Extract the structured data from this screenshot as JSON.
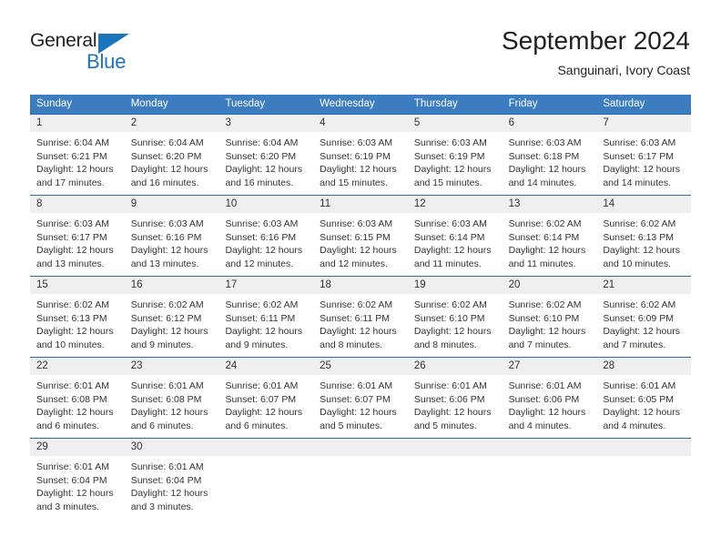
{
  "brand": {
    "name_top": "General",
    "name_bottom": "Blue",
    "accent_color": "#1b75bc",
    "triangle_icon": "triangle-icon"
  },
  "header": {
    "title": "September 2024",
    "subtitle": "Sanguinari, Ivory Coast"
  },
  "theme": {
    "header_row_bg": "#3b7dc0",
    "date_band_bg": "#efefef",
    "row_divider": "#2a6aad",
    "text_color": "#333333"
  },
  "calendar": {
    "weekday_headers": [
      "Sunday",
      "Monday",
      "Tuesday",
      "Wednesday",
      "Thursday",
      "Friday",
      "Saturday"
    ],
    "weeks": [
      {
        "days": [
          {
            "date": "1",
            "sunrise": "Sunrise: 6:04 AM",
            "sunset": "Sunset: 6:21 PM",
            "daylight_line1": "Daylight: 12 hours",
            "daylight_line2": "and 17 minutes."
          },
          {
            "date": "2",
            "sunrise": "Sunrise: 6:04 AM",
            "sunset": "Sunset: 6:20 PM",
            "daylight_line1": "Daylight: 12 hours",
            "daylight_line2": "and 16 minutes."
          },
          {
            "date": "3",
            "sunrise": "Sunrise: 6:04 AM",
            "sunset": "Sunset: 6:20 PM",
            "daylight_line1": "Daylight: 12 hours",
            "daylight_line2": "and 16 minutes."
          },
          {
            "date": "4",
            "sunrise": "Sunrise: 6:03 AM",
            "sunset": "Sunset: 6:19 PM",
            "daylight_line1": "Daylight: 12 hours",
            "daylight_line2": "and 15 minutes."
          },
          {
            "date": "5",
            "sunrise": "Sunrise: 6:03 AM",
            "sunset": "Sunset: 6:19 PM",
            "daylight_line1": "Daylight: 12 hours",
            "daylight_line2": "and 15 minutes."
          },
          {
            "date": "6",
            "sunrise": "Sunrise: 6:03 AM",
            "sunset": "Sunset: 6:18 PM",
            "daylight_line1": "Daylight: 12 hours",
            "daylight_line2": "and 14 minutes."
          },
          {
            "date": "7",
            "sunrise": "Sunrise: 6:03 AM",
            "sunset": "Sunset: 6:17 PM",
            "daylight_line1": "Daylight: 12 hours",
            "daylight_line2": "and 14 minutes."
          }
        ]
      },
      {
        "days": [
          {
            "date": "8",
            "sunrise": "Sunrise: 6:03 AM",
            "sunset": "Sunset: 6:17 PM",
            "daylight_line1": "Daylight: 12 hours",
            "daylight_line2": "and 13 minutes."
          },
          {
            "date": "9",
            "sunrise": "Sunrise: 6:03 AM",
            "sunset": "Sunset: 6:16 PM",
            "daylight_line1": "Daylight: 12 hours",
            "daylight_line2": "and 13 minutes."
          },
          {
            "date": "10",
            "sunrise": "Sunrise: 6:03 AM",
            "sunset": "Sunset: 6:16 PM",
            "daylight_line1": "Daylight: 12 hours",
            "daylight_line2": "and 12 minutes."
          },
          {
            "date": "11",
            "sunrise": "Sunrise: 6:03 AM",
            "sunset": "Sunset: 6:15 PM",
            "daylight_line1": "Daylight: 12 hours",
            "daylight_line2": "and 12 minutes."
          },
          {
            "date": "12",
            "sunrise": "Sunrise: 6:03 AM",
            "sunset": "Sunset: 6:14 PM",
            "daylight_line1": "Daylight: 12 hours",
            "daylight_line2": "and 11 minutes."
          },
          {
            "date": "13",
            "sunrise": "Sunrise: 6:02 AM",
            "sunset": "Sunset: 6:14 PM",
            "daylight_line1": "Daylight: 12 hours",
            "daylight_line2": "and 11 minutes."
          },
          {
            "date": "14",
            "sunrise": "Sunrise: 6:02 AM",
            "sunset": "Sunset: 6:13 PM",
            "daylight_line1": "Daylight: 12 hours",
            "daylight_line2": "and 10 minutes."
          }
        ]
      },
      {
        "days": [
          {
            "date": "15",
            "sunrise": "Sunrise: 6:02 AM",
            "sunset": "Sunset: 6:13 PM",
            "daylight_line1": "Daylight: 12 hours",
            "daylight_line2": "and 10 minutes."
          },
          {
            "date": "16",
            "sunrise": "Sunrise: 6:02 AM",
            "sunset": "Sunset: 6:12 PM",
            "daylight_line1": "Daylight: 12 hours",
            "daylight_line2": "and 9 minutes."
          },
          {
            "date": "17",
            "sunrise": "Sunrise: 6:02 AM",
            "sunset": "Sunset: 6:11 PM",
            "daylight_line1": "Daylight: 12 hours",
            "daylight_line2": "and 9 minutes."
          },
          {
            "date": "18",
            "sunrise": "Sunrise: 6:02 AM",
            "sunset": "Sunset: 6:11 PM",
            "daylight_line1": "Daylight: 12 hours",
            "daylight_line2": "and 8 minutes."
          },
          {
            "date": "19",
            "sunrise": "Sunrise: 6:02 AM",
            "sunset": "Sunset: 6:10 PM",
            "daylight_line1": "Daylight: 12 hours",
            "daylight_line2": "and 8 minutes."
          },
          {
            "date": "20",
            "sunrise": "Sunrise: 6:02 AM",
            "sunset": "Sunset: 6:10 PM",
            "daylight_line1": "Daylight: 12 hours",
            "daylight_line2": "and 7 minutes."
          },
          {
            "date": "21",
            "sunrise": "Sunrise: 6:02 AM",
            "sunset": "Sunset: 6:09 PM",
            "daylight_line1": "Daylight: 12 hours",
            "daylight_line2": "and 7 minutes."
          }
        ]
      },
      {
        "days": [
          {
            "date": "22",
            "sunrise": "Sunrise: 6:01 AM",
            "sunset": "Sunset: 6:08 PM",
            "daylight_line1": "Daylight: 12 hours",
            "daylight_line2": "and 6 minutes."
          },
          {
            "date": "23",
            "sunrise": "Sunrise: 6:01 AM",
            "sunset": "Sunset: 6:08 PM",
            "daylight_line1": "Daylight: 12 hours",
            "daylight_line2": "and 6 minutes."
          },
          {
            "date": "24",
            "sunrise": "Sunrise: 6:01 AM",
            "sunset": "Sunset: 6:07 PM",
            "daylight_line1": "Daylight: 12 hours",
            "daylight_line2": "and 6 minutes."
          },
          {
            "date": "25",
            "sunrise": "Sunrise: 6:01 AM",
            "sunset": "Sunset: 6:07 PM",
            "daylight_line1": "Daylight: 12 hours",
            "daylight_line2": "and 5 minutes."
          },
          {
            "date": "26",
            "sunrise": "Sunrise: 6:01 AM",
            "sunset": "Sunset: 6:06 PM",
            "daylight_line1": "Daylight: 12 hours",
            "daylight_line2": "and 5 minutes."
          },
          {
            "date": "27",
            "sunrise": "Sunrise: 6:01 AM",
            "sunset": "Sunset: 6:06 PM",
            "daylight_line1": "Daylight: 12 hours",
            "daylight_line2": "and 4 minutes."
          },
          {
            "date": "28",
            "sunrise": "Sunrise: 6:01 AM",
            "sunset": "Sunset: 6:05 PM",
            "daylight_line1": "Daylight: 12 hours",
            "daylight_line2": "and 4 minutes."
          }
        ]
      },
      {
        "days": [
          {
            "date": "29",
            "sunrise": "Sunrise: 6:01 AM",
            "sunset": "Sunset: 6:04 PM",
            "daylight_line1": "Daylight: 12 hours",
            "daylight_line2": "and 3 minutes."
          },
          {
            "date": "30",
            "sunrise": "Sunrise: 6:01 AM",
            "sunset": "Sunset: 6:04 PM",
            "daylight_line1": "Daylight: 12 hours",
            "daylight_line2": "and 3 minutes."
          },
          {
            "date": "",
            "sunrise": "",
            "sunset": "",
            "daylight_line1": "",
            "daylight_line2": ""
          },
          {
            "date": "",
            "sunrise": "",
            "sunset": "",
            "daylight_line1": "",
            "daylight_line2": ""
          },
          {
            "date": "",
            "sunrise": "",
            "sunset": "",
            "daylight_line1": "",
            "daylight_line2": ""
          },
          {
            "date": "",
            "sunrise": "",
            "sunset": "",
            "daylight_line1": "",
            "daylight_line2": ""
          },
          {
            "date": "",
            "sunrise": "",
            "sunset": "",
            "daylight_line1": "",
            "daylight_line2": ""
          }
        ]
      }
    ]
  }
}
